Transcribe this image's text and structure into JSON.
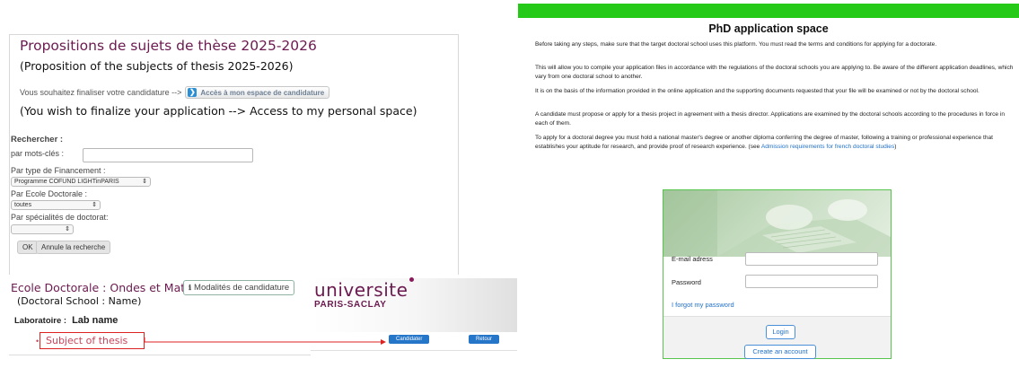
{
  "left": {
    "title": "Propositions de sujets de thèse 2025-2026",
    "subtitle": "(Proposition of the subjects of thesis 2025-2026)",
    "finalize_text": "Vous souhaitez finaliser votre candidature -->",
    "access_button": "Accès à mon espace de candidature",
    "finalize_english": "(You wish to finalize your application --> Access to my personal space)",
    "search": {
      "heading": "Rechercher :",
      "keywords_label": "par mots-clés :",
      "keywords_value": "",
      "funding_label": "Par type de Financement :",
      "funding_value": "Programme COFUND LIGHTinPARIS",
      "ed_label": "Par Ecole Doctorale :",
      "ed_value": "toutes",
      "spec_label": "Par spécialités de doctorat:",
      "spec_value": "",
      "ok": "OK",
      "cancel": "Annule la recherche"
    },
    "ed_title": "Ecole Doctorale : Ondes et Matière",
    "modalites_button": "Modalités de candidature",
    "ed_subtitle": "(Doctoral School :  Name)",
    "lab_key": "Laboratoire :",
    "lab_value": "Lab name",
    "subject": "Subject of thesis"
  },
  "middle": {
    "logo_line1": "universite",
    "logo_line2": "PARIS-SACLAY",
    "candidater": "Candidater",
    "retour": "Retour"
  },
  "right": {
    "title": "PhD application space",
    "paragraphs": {
      "p1": "Before taking any steps, make sure that the target doctoral school uses this platform. You must read the terms and conditions for applying for a doctorate.",
      "p2": "This will allow you to compile your application files in accordance with the regulations of the doctoral schools you are applying to. Be aware of the different application deadlines, which vary from one doctoral school to another.",
      "p3": "It is on the basis of the information provided in the online application and the supporting documents requested that your file will be examined or not by the doctoral school.",
      "p4": "A candidate must propose or apply for a thesis project in agreement with a thesis director. Applications are examined by the doctoral schools according to the procedures in force in each of them.",
      "p5_text": "To apply for a doctoral degree you must hold a national master's degree or another diploma conferring the degree of master, following a training or professional experience that establishes your aptitude for research, and provide proof of research experience. (see ",
      "p5_link": "Admission requirements for french doctoral studies",
      "p5_end": ")"
    },
    "login": {
      "email_label": "E-mail adress",
      "email_value": "",
      "password_label": "Password",
      "password_value": "",
      "forgot": "I forgot my password",
      "login_button": "Login",
      "create_button": "Create an account"
    }
  },
  "colors": {
    "brand_purple": "#6b1a4f",
    "green_bar": "#25c918",
    "link_blue": "#2070c8",
    "highlight_red": "#dd2222"
  }
}
